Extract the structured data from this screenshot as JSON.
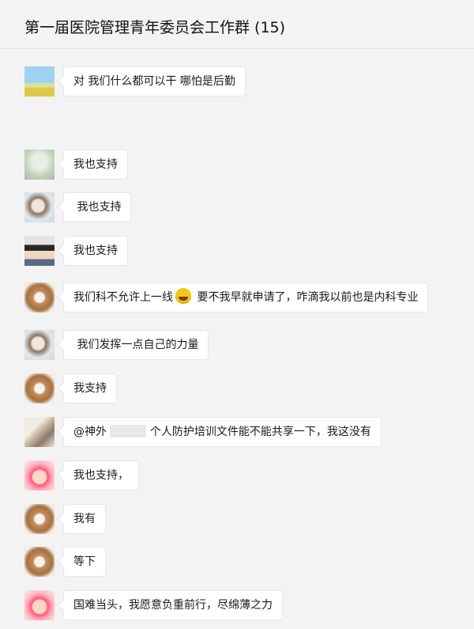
{
  "header": {
    "title": "第一届医院管理青年委员会工作群 (15)"
  },
  "messages": [
    {
      "avatar": "landscape-avatar",
      "text": "对 我们什么都可以干 哪怕是后勤"
    },
    {
      "avatar": "statue-avatar",
      "text": "我也支持"
    },
    {
      "avatar": "girl-avatar",
      "text": " 我也支持"
    },
    {
      "avatar": "boy-avatar",
      "text": "我也支持"
    },
    {
      "avatar": "dog-avatar",
      "text_a": "我们科不允许上一线",
      "emoji": "laughing-tears-emoji",
      "text_b": " 要不我早就申请了，咋滴我以前也是内科专业"
    },
    {
      "avatar": "girl-avatar",
      "text": " 我们发挥一点自己的力量"
    },
    {
      "avatar": "dog-avatar",
      "text": "我支持"
    },
    {
      "avatar": "hair-avatar",
      "text_a": "@神外 ",
      "text_b": " 个人防护培训文件能不能共享一下，我这没有"
    },
    {
      "avatar": "cartoon-avatar",
      "text": "我也支持，"
    },
    {
      "avatar": "dog-avatar",
      "text": "我有"
    },
    {
      "avatar": "dog-avatar",
      "text": "等下"
    },
    {
      "avatar": "cartoon-avatar",
      "text": "国难当头，我愿意负重前行，尽绵薄之力"
    }
  ]
}
